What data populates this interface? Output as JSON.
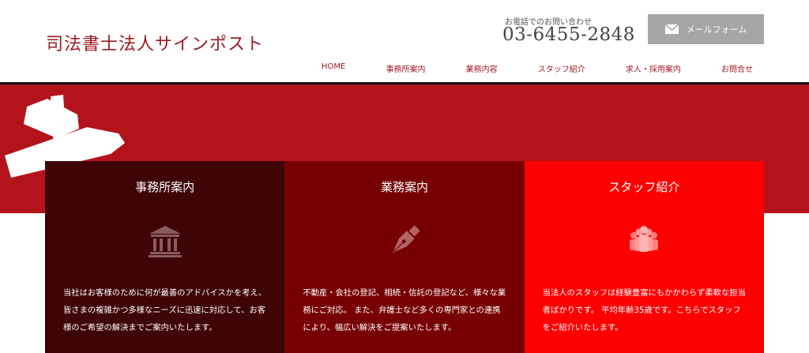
{
  "header": {
    "logo": "司法書士法人サインポスト",
    "tel_label": "お電話でのお問い合わせ",
    "tel_number": "03-6455-2848",
    "mail_button_label": "メールフォーム",
    "mail_icon": "envelope-icon"
  },
  "nav": {
    "items": [
      {
        "label": "HOME"
      },
      {
        "label": "事務所案内"
      },
      {
        "label": "業務内容"
      },
      {
        "label": "スタッフ紹介"
      },
      {
        "label": "求人・採用案内"
      },
      {
        "label": "お問合せ"
      }
    ]
  },
  "colors": {
    "brand_red": "#9e1a22",
    "hero_red": "#b3141c",
    "card1_bg": "#3f0406",
    "card2_bg": "#770102",
    "card3_bg": "#fd0000",
    "mail_button_bg": "#a6a6a6"
  },
  "cards": [
    {
      "title": "事務所案内",
      "icon": "bank-building-icon",
      "text": "当社はお客様のために何が最善のアドバイスかを考え、皆さまの複雑かつ多様なニーズに迅速に対応して、お客様のご希望の解決までご案内いたします。"
    },
    {
      "title": "業務案内",
      "icon": "fountain-pen-icon",
      "text": "不動産・会社の登記、相続・信託の登記など、様々な業務にご対応。 また、弁護士など多くの専門家との連携により、幅広い解決をご提案いたします。"
    },
    {
      "title": "スタッフ紹介",
      "icon": "staff-group-icon",
      "text": "当法人のスタッフは経験豊富にもかかわらず柔軟な担当者ばかりです。 平均年齢35歳です。こちらでスタッフをご紹介いたします。"
    }
  ]
}
